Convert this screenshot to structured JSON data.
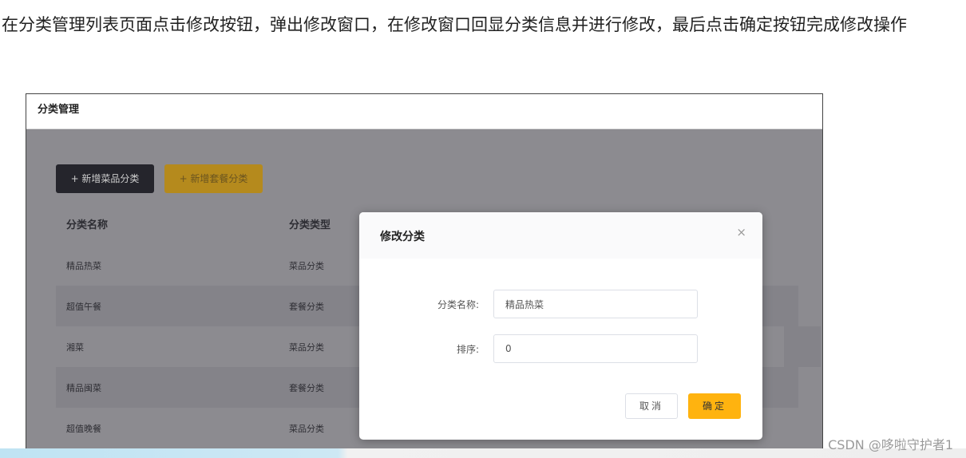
{
  "intro": {
    "text": "在分类管理列表页面点击修改按钮，弹出修改窗口，在修改窗口回显分类信息并进行修改，最后点击确定按钮完成修改操作"
  },
  "app": {
    "title": "分类管理",
    "buttons": {
      "add_dish": "+ 新增菜品分类",
      "add_set": "+ 新增套餐分类"
    },
    "table": {
      "headers": [
        "分类名称",
        "分类类型"
      ],
      "rows": [
        {
          "name": "精品热菜",
          "type": "菜品分类"
        },
        {
          "name": "超值午餐",
          "type": "套餐分类"
        },
        {
          "name": "湘菜",
          "type": "菜品分类"
        },
        {
          "name": "精品闽菜",
          "type": "套餐分类"
        },
        {
          "name": "超值晚餐",
          "type": "菜品分类"
        }
      ]
    }
  },
  "modal": {
    "title": "修改分类",
    "close_icon": "×",
    "name_label": "分类名称:",
    "name_value": "精品热菜",
    "sort_label": "排序:",
    "sort_value": "0",
    "cancel_label": "取消",
    "ok_label": "确定"
  },
  "watermark": "CSDN @哆啦守护者1",
  "colors": {
    "accent": "#ffb30f",
    "overlay": "#8c8b90",
    "dark_button": "#25252c"
  }
}
